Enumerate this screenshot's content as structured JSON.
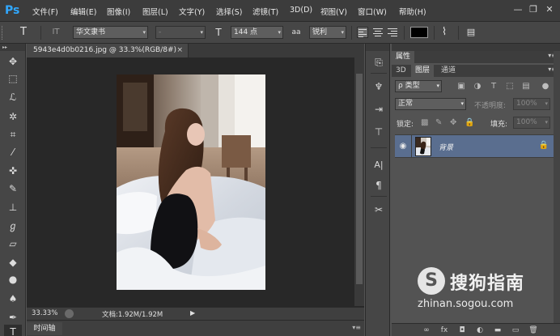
{
  "app": {
    "logo": "Ps"
  },
  "menu": {
    "items": [
      "文件(F)",
      "编辑(E)",
      "图像(I)",
      "图层(L)",
      "文字(Y)",
      "选择(S)",
      "滤镜(T)",
      "3D(D)",
      "视图(V)",
      "窗口(W)",
      "帮助(H)"
    ],
    "minimize": "—",
    "restore": "❐",
    "close": "✕"
  },
  "options": {
    "tool_glyph": "T",
    "orient_glyph": "IT",
    "font_family": "华文隶书",
    "font_style": "-",
    "size_glyph": "T",
    "font_size": "144 点",
    "aa_glyph": "aa",
    "anti_alias": "锐利",
    "color": "#000000",
    "warp_glyph": "⌇",
    "panels_glyph": "▤"
  },
  "document": {
    "tab_title": "5943e4d0b0216.jpg @ 33.3%(RGB/8#)",
    "tab_close": "×"
  },
  "status": {
    "zoom": "33.33%",
    "doc_info": "文档:1.92M/1.92M",
    "arrow": "▶"
  },
  "timeline": {
    "label": "时间轴",
    "menu": "▾≡"
  },
  "tools": [
    {
      "name": "move-tool-icon",
      "glyph": "✥"
    },
    {
      "name": "marquee-tool-icon",
      "glyph": "⬚"
    },
    {
      "name": "lasso-tool-icon",
      "glyph": "ℒ"
    },
    {
      "name": "magic-wand-tool-icon",
      "glyph": "✲"
    },
    {
      "name": "crop-tool-icon",
      "glyph": "⌗"
    },
    {
      "name": "eyedropper-tool-icon",
      "glyph": "⁄"
    },
    {
      "name": "healing-brush-tool-icon",
      "glyph": "✜"
    },
    {
      "name": "brush-tool-icon",
      "glyph": "✎"
    },
    {
      "name": "clone-stamp-tool-icon",
      "glyph": "⊥"
    },
    {
      "name": "history-brush-tool-icon",
      "glyph": "ℊ"
    },
    {
      "name": "eraser-tool-icon",
      "glyph": "▱"
    },
    {
      "name": "paint-bucket-tool-icon",
      "glyph": "◆"
    },
    {
      "name": "blur-tool-icon",
      "glyph": "●"
    },
    {
      "name": "dodge-tool-icon",
      "glyph": "♠"
    },
    {
      "name": "pen-tool-icon",
      "glyph": "✒"
    },
    {
      "name": "type-tool-icon",
      "glyph": "T"
    }
  ],
  "panel_icons": [
    {
      "name": "history-panel-icon",
      "glyph": "⎘"
    },
    {
      "name": "brush-preset-panel-icon",
      "glyph": "♆"
    },
    {
      "name": "brush-panel-icon",
      "glyph": "⇥"
    },
    {
      "name": "tool-presets-panel-icon",
      "glyph": "⊤"
    },
    {
      "name": "character-panel-icon",
      "glyph": "A|"
    },
    {
      "name": "paragraph-panel-icon",
      "glyph": "¶"
    },
    {
      "name": "scissors-panel-icon",
      "glyph": "✂"
    }
  ],
  "properties_header": "属性",
  "layers_panel": {
    "tabs": [
      "3D",
      "图层",
      "通道"
    ],
    "active_tab": "图层",
    "menu": "▾≡",
    "filter_kind": "ρ 类型",
    "blend_mode": "正常",
    "opacity_label": "不透明度:",
    "opacity_value": "100%",
    "lock_label": "锁定:",
    "fill_label": "填充:",
    "fill_value": "100%",
    "layer": {
      "name": "背景",
      "visible_glyph": "👁",
      "lock_glyph": "🔒"
    }
  },
  "layer_footer": [
    {
      "name": "link-layers-icon",
      "glyph": "∞"
    },
    {
      "name": "fx-icon",
      "glyph": "fx"
    },
    {
      "name": "add-mask-icon",
      "glyph": "◘"
    },
    {
      "name": "adjustment-layer-icon",
      "glyph": "◐"
    },
    {
      "name": "new-group-icon",
      "glyph": "▬"
    },
    {
      "name": "new-layer-icon",
      "glyph": "▭"
    },
    {
      "name": "delete-layer-icon",
      "glyph": "🗑"
    }
  ],
  "watermark": {
    "circle": "S",
    "title": "搜狗指南",
    "url": "zhinan.sogou.com"
  }
}
